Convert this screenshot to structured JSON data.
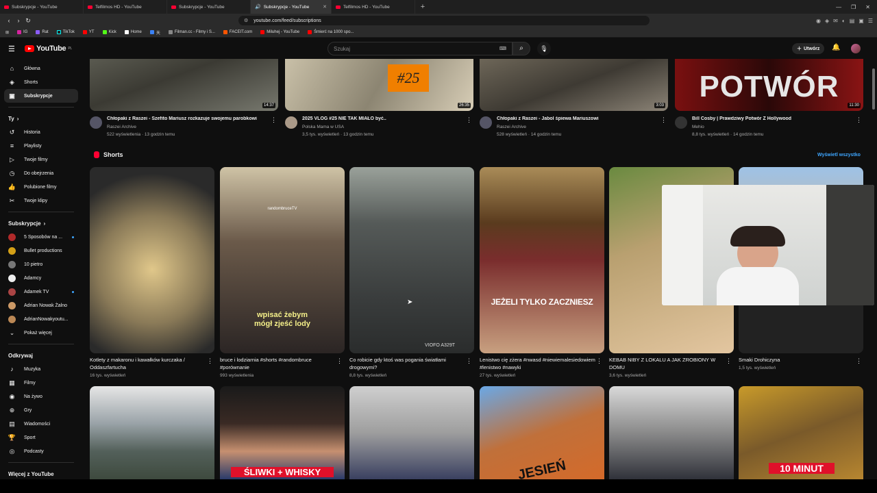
{
  "browser": {
    "tabs": [
      {
        "label": "Subskrypcje - YouTube",
        "active": false
      },
      {
        "label": "Telfilmos HD - YouTube",
        "active": false
      },
      {
        "label": "Subskrypcje - YouTube",
        "active": false
      },
      {
        "label": "Subskrypcje - YouTube",
        "active": true
      },
      {
        "label": "Telfilmos HD - YouTube",
        "active": false
      }
    ],
    "url": "youtube.com/feed/subscriptions",
    "bookmarks": [
      "IG",
      "Rat",
      "TikTok",
      "YT",
      "Kick",
      "Home",
      "天",
      "Filman.cc - Filmy i S...",
      "FACEIT.com",
      "Miluhej - YouTube",
      "Śmierć na 1000 spo..."
    ]
  },
  "header": {
    "logo_text": "YouTube",
    "logo_region": "PL",
    "search_placeholder": "Szukaj",
    "create_label": "Utwórz"
  },
  "sidebar": {
    "main": [
      {
        "label": "Główna",
        "icon": "home-icon"
      },
      {
        "label": "Shorts",
        "icon": "shorts-icon"
      },
      {
        "label": "Subskrypcje",
        "icon": "subscriptions-icon",
        "active": true
      }
    ],
    "you_title": "Ty",
    "you": [
      {
        "label": "Historia",
        "icon": "history-icon"
      },
      {
        "label": "Playlisty",
        "icon": "playlist-icon"
      },
      {
        "label": "Twoje filmy",
        "icon": "your-videos-icon"
      },
      {
        "label": "Do obejrzenia",
        "icon": "watch-later-icon"
      },
      {
        "label": "Polubione filmy",
        "icon": "like-icon"
      },
      {
        "label": "Twoje klipy",
        "icon": "clips-icon"
      }
    ],
    "subs_title": "Subskrypcje",
    "subs": [
      {
        "label": "5 Sposobów na ...",
        "color": "#b02a2a",
        "dot": true
      },
      {
        "label": "Bullet productions",
        "color": "#d4a017",
        "dot": false
      },
      {
        "label": "10 pietro",
        "color": "#777",
        "dot": false
      },
      {
        "label": "Adamcy",
        "color": "#eee",
        "dot": false
      },
      {
        "label": "Adamek TV",
        "color": "#a44",
        "dot": true
      },
      {
        "label": "Adrian Nowak Żalno",
        "color": "#c96",
        "dot": false
      },
      {
        "label": "AdrianNowakyoutu...",
        "color": "#b85",
        "dot": false
      }
    ],
    "show_more": "Pokaż więcej",
    "explore_title": "Odkrywaj",
    "explore": [
      {
        "label": "Muzyka",
        "icon": "music-icon"
      },
      {
        "label": "Filmy",
        "icon": "film-icon"
      },
      {
        "label": "Na żywo",
        "icon": "live-icon"
      },
      {
        "label": "Gry",
        "icon": "gaming-icon"
      },
      {
        "label": "Wiadomości",
        "icon": "news-icon"
      },
      {
        "label": "Sport",
        "icon": "trophy-icon"
      },
      {
        "label": "Podcasty",
        "icon": "podcast-icon"
      }
    ],
    "more_title": "Więcej z YouTube"
  },
  "videos": [
    {
      "title": "Chłopaki z Raszei - Szefito Mariusz rozkazuje swojemu parobkowi",
      "channel": "Raszei Archive",
      "meta": "522 wyświetlenia · 13 godzin temu",
      "duration": "14:37",
      "avatar": "#556"
    },
    {
      "title": "2025 VLOG #25 NIE TAK MIAŁO być..",
      "channel": "Polska Mama w USA",
      "meta": "3,5 tys. wyświetleń · 13 godzin temu",
      "duration": "26:35",
      "overlay": "#25",
      "avatar": "#a98"
    },
    {
      "title": "Chłopaki z Raszei - Jabol śpiewa Mariuszowi",
      "channel": "Raszei Archive",
      "meta": "528 wyświetleń · 14 godzin temu",
      "duration": "3:03",
      "avatar": "#556"
    },
    {
      "title": "Bill Cosby | Prawdziwy Potwór Z Hollywood",
      "channel": "Mehio",
      "meta": "8,8 tys. wyświetleń · 14 godzin temu",
      "duration": "11:30",
      "overlay": "POTWÓR",
      "avatar": "#333"
    }
  ],
  "shorts_title": "Shorts",
  "see_all": "Wyświetl wszystko",
  "shorts": [
    {
      "title": "Kotlety z makaronu i kawałków kurczaka / Oddaszfartucha",
      "views": "16 tys. wyświetleń"
    },
    {
      "title": "bruce i lodziarnia #shorts #randombruce #porównanie",
      "views": "993 wyświetlenia",
      "caption": "wpisać żebym mógł zjeść lody",
      "watermark": "randombruceTV"
    },
    {
      "title": "Co robicie gdy ktoś was pogania światłami drogowymi?",
      "views": "8,8 tys. wyświetleń",
      "watermark": "VIOFO A329T"
    },
    {
      "title": "Lenistwo cię zżera #nwasd #niewiemalesiedowiem #lenistwo #nawyki",
      "views": "27 tys. wyświetleń",
      "caption": "JEŻELI TYLKO ZACZNIESZ"
    },
    {
      "title": "KEBAB NIBY Z LOKALU A JAK ZROBIONY W DOMU",
      "views": "3,6 tys. wyświetleń"
    },
    {
      "title": "Smaki Drohiczyna",
      "views": "1,5 tys. wyświetleń"
    }
  ],
  "shorts_row2": [
    {
      "caption": ""
    },
    {
      "caption": "ŚLIWKI + WHISKY"
    },
    {
      "caption": ""
    },
    {
      "caption": "JESIEŃ"
    },
    {
      "caption": ""
    },
    {
      "caption": "10 MINUT"
    }
  ]
}
